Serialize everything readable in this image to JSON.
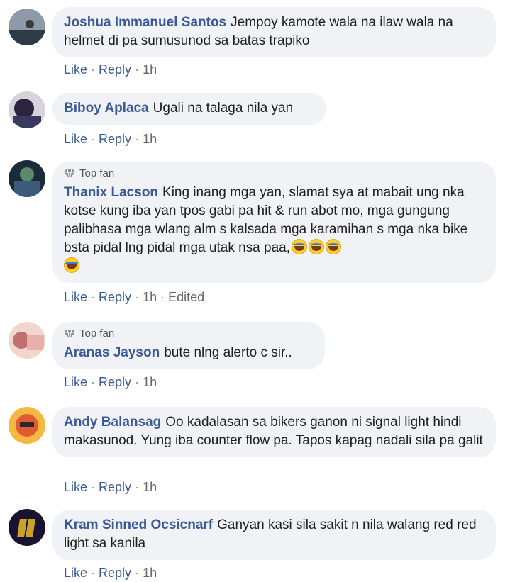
{
  "comments": [
    {
      "author": "Joshua Immanuel Santos",
      "text": "Jempoy kamote wala na ilaw wala na helmet di pa sumusunod sa batas trapiko",
      "badge": "",
      "like": "Like",
      "reply": "Reply",
      "time": "1h",
      "edited": "",
      "avatar_colors": [
        "#6b7a8a",
        "#2e3b47"
      ]
    },
    {
      "author": "Biboy Aplaca",
      "text": "Ugali na talaga nila yan",
      "badge": "",
      "like": "Like",
      "reply": "Reply",
      "time": "1h",
      "edited": "",
      "avatar_colors": [
        "#c9c2cf",
        "#2b2440"
      ]
    },
    {
      "author": "Thanix Lacson",
      "text": "King inang mga yan, slamat sya at mabait ung nka kotse kung iba yan tpos gabi pa hit & run abot mo, mga gungung palibhasa mga wlang alm s kalsada mga karamihan s mga nka bike bsta pidal lng pidal mga utak nsa paa,",
      "badge": "Top fan",
      "like": "Like",
      "reply": "Reply",
      "time": "1h",
      "edited": "Edited",
      "avatar_colors": [
        "#4a6b5c",
        "#1c2b3a"
      ]
    },
    {
      "author": "Aranas Jayson",
      "text": "bute nlng alerto c sir..",
      "badge": "Top fan",
      "like": "Like",
      "reply": "Reply",
      "time": "1h",
      "edited": "",
      "avatar_colors": [
        "#e9b9b0",
        "#b86a6a"
      ]
    },
    {
      "author": "Andy Balansag",
      "text": "Oo kadalasan sa bikers ganon ni signal light hindi makasunod. Yung iba counter flow pa. Tapos kapag nadali sila pa galit",
      "badge": "",
      "like": "Like",
      "reply": "Reply",
      "time": "1h",
      "edited": "",
      "avatar_colors": [
        "#f2a33a",
        "#e04a2a"
      ]
    },
    {
      "author": "Kram Sinned Ocsicnarf",
      "text": "Ganyan kasi sila sakit n nila walang red red light sa kanila",
      "badge": "",
      "like": "Like",
      "reply": "Reply",
      "time": "1h",
      "edited": "",
      "avatar_colors": [
        "#3b2a5a",
        "#1a1230"
      ]
    }
  ],
  "separator": "·",
  "badge_icon": "diamond-icon",
  "emoji_icon": "laughing-tears-emoji"
}
